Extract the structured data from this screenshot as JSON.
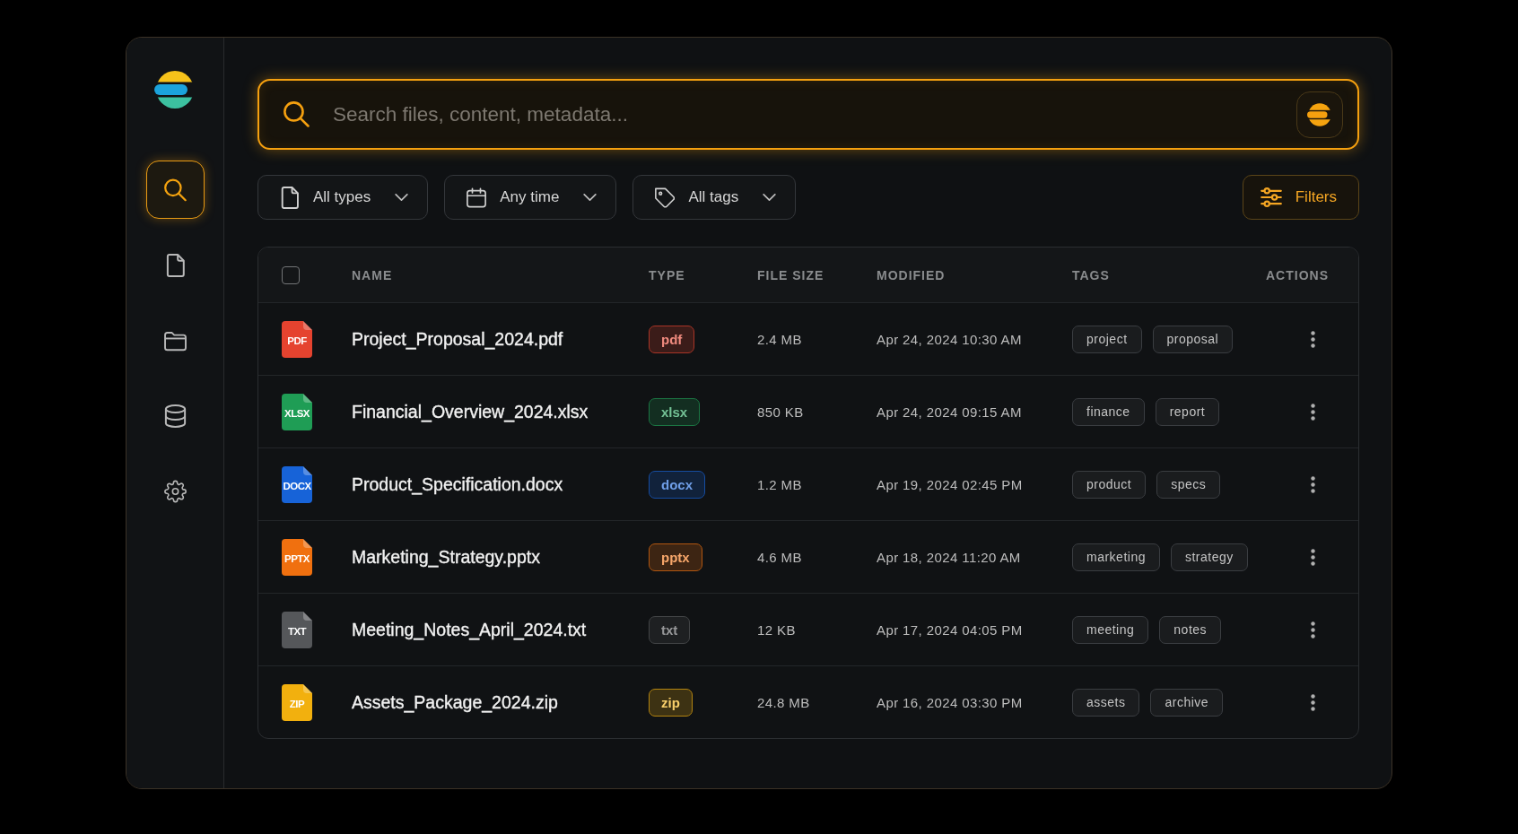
{
  "sidebar": {
    "items": [
      {
        "kind": "search",
        "selected": true
      },
      {
        "kind": "document",
        "selected": false
      },
      {
        "kind": "folder",
        "selected": false
      },
      {
        "kind": "database",
        "selected": false
      },
      {
        "kind": "settings",
        "selected": false
      }
    ]
  },
  "search": {
    "placeholder": "Search files, content, metadata..."
  },
  "filters": [
    {
      "kind": "type",
      "label": "All types"
    },
    {
      "kind": "date",
      "label": "Any time"
    },
    {
      "kind": "tag",
      "label": "All tags"
    }
  ],
  "filters_button": {
    "label": "Filters"
  },
  "table": {
    "select_all": {
      "checked": false
    },
    "columns": [
      "NAME",
      "TYPE",
      "FILE SIZE",
      "MODIFIED",
      "TAGS",
      "ACTIONS"
    ],
    "rows": [
      {
        "icon_label": "PDF",
        "color": "#e5432f",
        "name": "Project_Proposal_2024.pdf",
        "type": "pdf",
        "size": "2.4 MB",
        "modified": "Apr 24, 2024 10:30 AM",
        "tags": [
          "project",
          "proposal"
        ]
      },
      {
        "icon_label": "XLSX",
        "color": "#1f9d55",
        "name": "Financial_Overview_2024.xlsx",
        "type": "xlsx",
        "size": "850 KB",
        "modified": "Apr 24, 2024 09:15 AM",
        "tags": [
          "finance",
          "report"
        ]
      },
      {
        "icon_label": "DOCX",
        "color": "#1763d8",
        "name": "Product_Specification.docx",
        "type": "docx",
        "size": "1.2 MB",
        "modified": "Apr 19, 2024 02:45 PM",
        "tags": [
          "product",
          "specs"
        ]
      },
      {
        "icon_label": "PPTX",
        "color": "#f0700f",
        "name": "Marketing_Strategy.pptx",
        "type": "pptx",
        "size": "4.6 MB",
        "modified": "Apr 18, 2024 11:20 AM",
        "tags": [
          "marketing",
          "strategy"
        ]
      },
      {
        "icon_label": "TXT",
        "color": "#55575a",
        "name": "Meeting_Notes_April_2024.txt",
        "type": "txt",
        "size": "12 KB",
        "modified": "Apr 17, 2024 04:05 PM",
        "tags": [
          "meeting",
          "notes"
        ]
      },
      {
        "icon_label": "ZIP",
        "color": "#f2b00e",
        "name": "Assets_Package_2024.zip",
        "type": "zip",
        "size": "24.8 MB",
        "modified": "Apr 16, 2024 03:30 PM",
        "tags": [
          "assets",
          "archive"
        ]
      }
    ]
  }
}
